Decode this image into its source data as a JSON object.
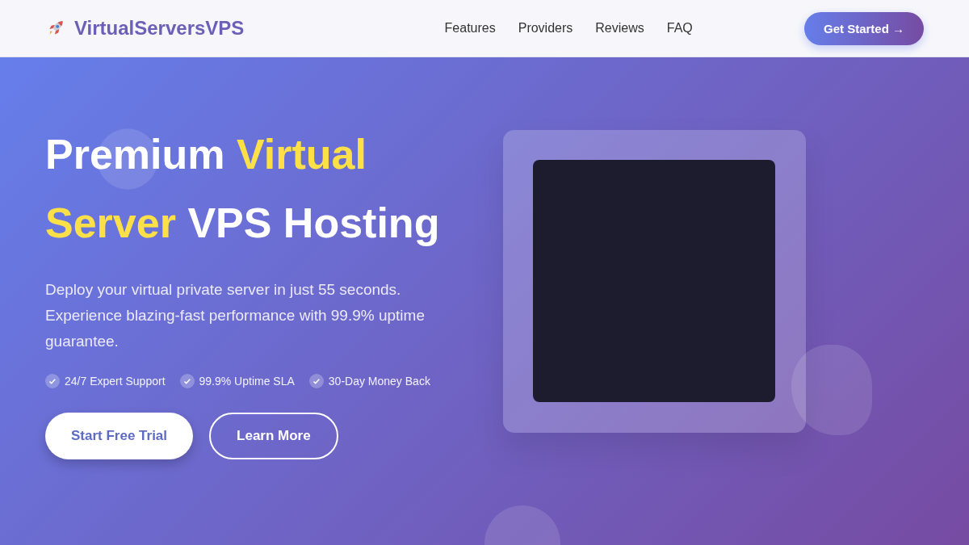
{
  "header": {
    "logo": "VirtualServersVPS",
    "nav": [
      {
        "label": "Features"
      },
      {
        "label": "Providers"
      },
      {
        "label": "Reviews"
      },
      {
        "label": "FAQ"
      }
    ],
    "cta": "Get Started →"
  },
  "hero": {
    "title": [
      {
        "text": "Premium",
        "highlight": false
      },
      {
        "text": "Virtual",
        "highlight": true
      },
      {
        "text": "Server",
        "highlight": true
      },
      {
        "text": "VPS Hosting",
        "highlight": false
      }
    ],
    "description": "Deploy your virtual private server in just 55 seconds. Experience blazing-fast performance with 99.9% uptime guarantee.",
    "features": [
      "24/7 Expert Support",
      "99.9% Uptime SLA",
      "30-Day Money Back"
    ],
    "buttons": [
      {
        "label": "Start Free Trial",
        "kind": "primary"
      },
      {
        "label": "Learn More",
        "kind": "outline"
      }
    ]
  }
}
